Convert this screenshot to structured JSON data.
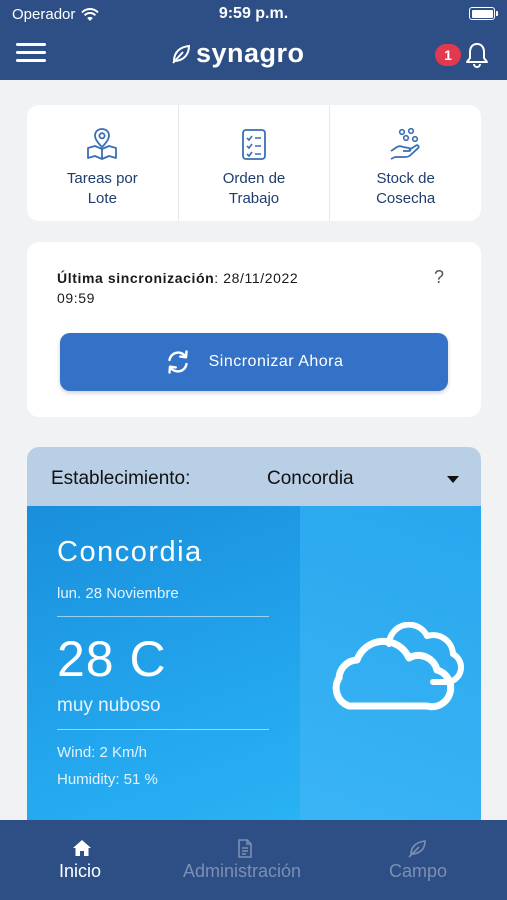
{
  "status_bar": {
    "carrier": "Operador",
    "time": "9:59 p.m."
  },
  "header": {
    "app_name": "synagro",
    "notification_count": "1"
  },
  "quick_actions": [
    {
      "label_line1": "Tareas por",
      "label_line2": "Lote",
      "icon": "map-pin-icon"
    },
    {
      "label_line1": "Orden de",
      "label_line2": "Trabajo",
      "icon": "checklist-icon"
    },
    {
      "label_line1": "Stock de",
      "label_line2": "Cosecha",
      "icon": "harvest-hand-icon"
    }
  ],
  "sync": {
    "last_sync_label": "Última sincronización",
    "last_sync_value": ": 28/11/2022",
    "last_sync_time": "09:59",
    "help": "?",
    "button_label": "Sincronizar Ahora"
  },
  "weather": {
    "establishment_label": "Establecimiento:",
    "establishment_value": "Concordia",
    "city": "Concordia",
    "date": "lun. 28 Noviembre",
    "temperature": "28 C",
    "description": "muy nuboso",
    "wind": "Wind: 2 Km/h",
    "humidity": "Humidity: 51 %",
    "icon": "cloudy-icon"
  },
  "tabs": [
    {
      "label": "Inicio",
      "icon": "home-icon",
      "active": true
    },
    {
      "label": "Administración",
      "icon": "document-icon",
      "active": false
    },
    {
      "label": "Campo",
      "icon": "leaf-icon",
      "active": false
    }
  ],
  "colors": {
    "header": "#2e4f86",
    "accent": "#3472c7",
    "badge": "#e2394f",
    "weather_bar": "#b8cfe6",
    "weather_panel": "#25aaf0"
  }
}
